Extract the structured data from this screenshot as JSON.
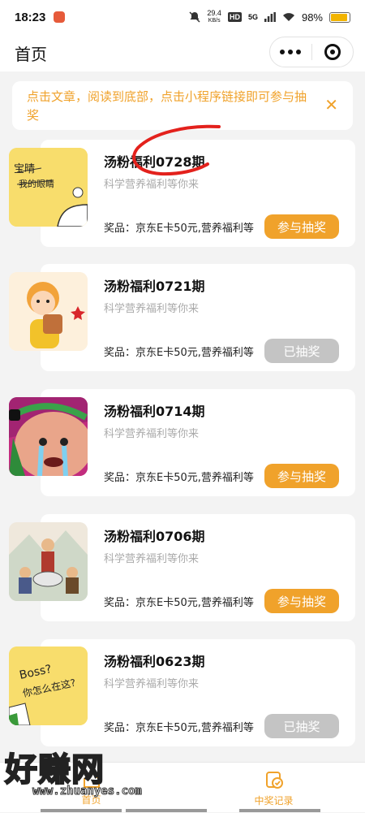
{
  "status_bar": {
    "time": "18:23",
    "net_speed_value": "29.4",
    "net_speed_unit": "KB/s",
    "hd_label": "HD",
    "network": "5G",
    "battery": "98%"
  },
  "nav": {
    "title": "首页"
  },
  "notice": {
    "text": "点击文章，阅读到底部，点击小程序链接即可参与抽奖",
    "close_icon": "close-icon"
  },
  "cards": [
    {
      "title": "汤粉福利0728期",
      "subtitle": "科学营养福利等你来",
      "prize": "奖品：京东E卡50元,营养福利等",
      "button": "参与抽奖",
      "thumb_text": "宝晴\n我的眼睛"
    },
    {
      "title": "汤粉福利0721期",
      "subtitle": "科学营养福利等你来",
      "prize": "奖品：京东E卡50元,营养福利等",
      "button": "已抽奖"
    },
    {
      "title": "汤粉福利0714期",
      "subtitle": "科学营养福利等你来",
      "prize": "奖品：京东E卡50元,营养福利等",
      "button": "参与抽奖"
    },
    {
      "title": "汤粉福利0706期",
      "subtitle": "科学营养福利等你来",
      "prize": "奖品：京东E卡50元,营养福利等",
      "button": "参与抽奖"
    },
    {
      "title": "汤粉福利0623期",
      "subtitle": "科学营养福利等你来",
      "prize": "奖品：京东E卡50元,营养福利等",
      "button": "已抽奖",
      "thumb_text": "Boss?\n你怎么在这?"
    }
  ],
  "tabbar": {
    "home": "首页",
    "records": "中奖记录"
  },
  "watermark": {
    "text": "好赚网",
    "url": "www.zhuanyes.com"
  },
  "colors": {
    "accent": "#f0a22b",
    "disabled": "#c4c4c4"
  }
}
